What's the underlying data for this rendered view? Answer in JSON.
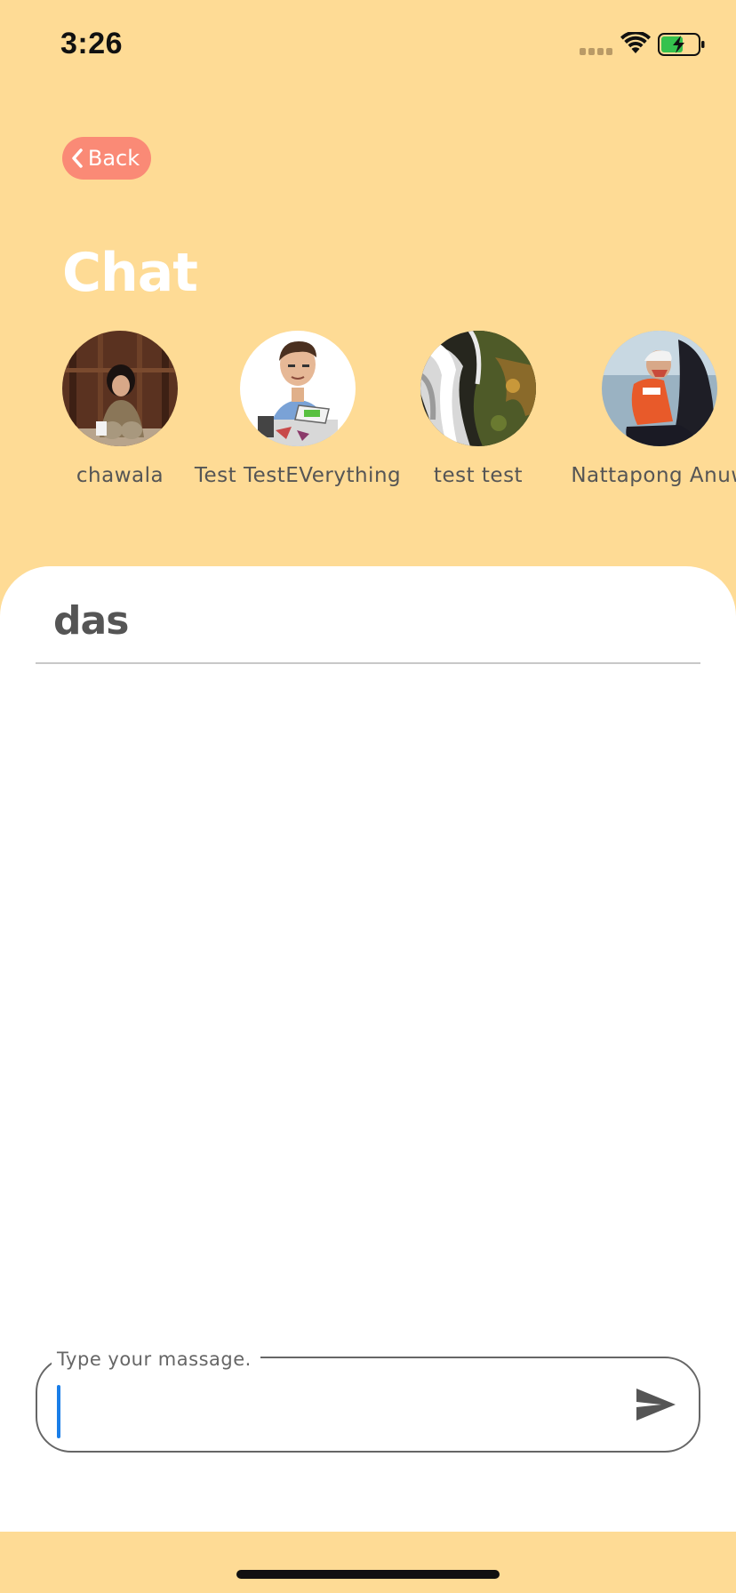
{
  "status_bar": {
    "time": "3:26"
  },
  "header": {
    "back_label": "Back",
    "title": "Chat"
  },
  "contacts": [
    {
      "name": "chawala"
    },
    {
      "name": "Test TestEVerything"
    },
    {
      "name": "test test"
    },
    {
      "name": "Nattapong Anuw"
    }
  ],
  "conversation": {
    "name": "das"
  },
  "composer": {
    "placeholder": "Type your massage."
  },
  "colors": {
    "background": "#fedb95",
    "back_button": "#fa8a76",
    "panel": "#ffffff",
    "caret": "#1a7ee8"
  }
}
